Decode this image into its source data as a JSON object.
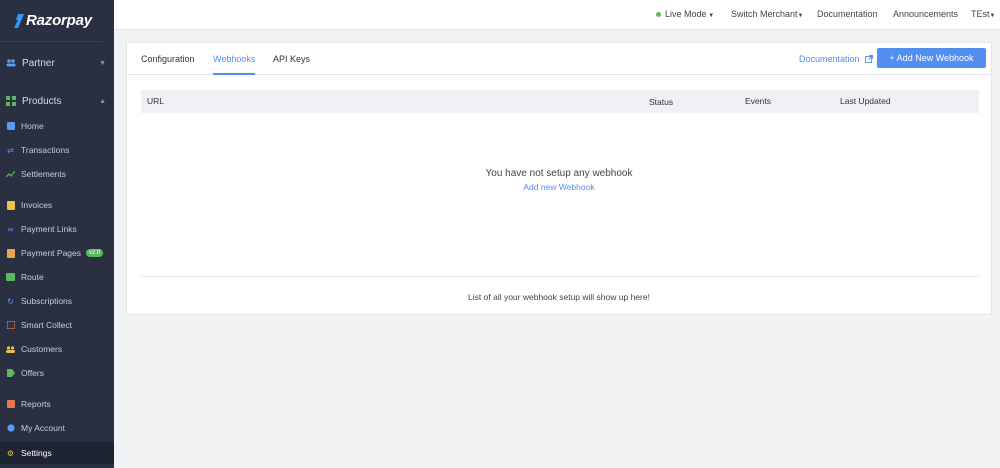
{
  "brand": {
    "name": "Razorpay"
  },
  "topbar": {
    "live_mode": "Live Mode",
    "switch_merchant": "Switch Merchant",
    "documentation": "Documentation",
    "announcements": "Announcements",
    "user": "TEst"
  },
  "sidebar": {
    "partner": "Partner",
    "products": "Products",
    "items": [
      {
        "label": "Home",
        "icon": "home-icon"
      },
      {
        "label": "Transactions",
        "icon": "transactions-icon"
      },
      {
        "label": "Settlements",
        "icon": "settlements-icon"
      },
      {
        "label": "Invoices",
        "icon": "invoices-icon"
      },
      {
        "label": "Payment Links",
        "icon": "link-icon"
      },
      {
        "label": "Payment Pages",
        "icon": "payment-pages-icon",
        "badge": "v2.0"
      },
      {
        "label": "Route",
        "icon": "route-icon"
      },
      {
        "label": "Subscriptions",
        "icon": "subscriptions-icon"
      },
      {
        "label": "Smart Collect",
        "icon": "smart-collect-icon"
      },
      {
        "label": "Customers",
        "icon": "customers-icon"
      },
      {
        "label": "Offers",
        "icon": "offers-icon"
      },
      {
        "label": "Reports",
        "icon": "reports-icon"
      },
      {
        "label": "My Account",
        "icon": "account-icon"
      },
      {
        "label": "Settings",
        "icon": "settings-icon"
      }
    ]
  },
  "tabs": [
    {
      "label": "Configuration"
    },
    {
      "label": "Webhooks"
    },
    {
      "label": "API Keys"
    }
  ],
  "actions": {
    "documentation": "Documentation",
    "add_webhook": "+ Add New Webhook"
  },
  "table": {
    "columns": [
      "URL",
      "Status",
      "Events",
      "Last Updated"
    ]
  },
  "empty": {
    "title": "You have not setup any webhook",
    "link": "Add new Webhook",
    "footer": "List of all your webhook setup will show up here!"
  },
  "colors": {
    "sidebar_bg": "#2a3041",
    "accent": "#528ff0",
    "live_dot": "#5cb85c"
  }
}
